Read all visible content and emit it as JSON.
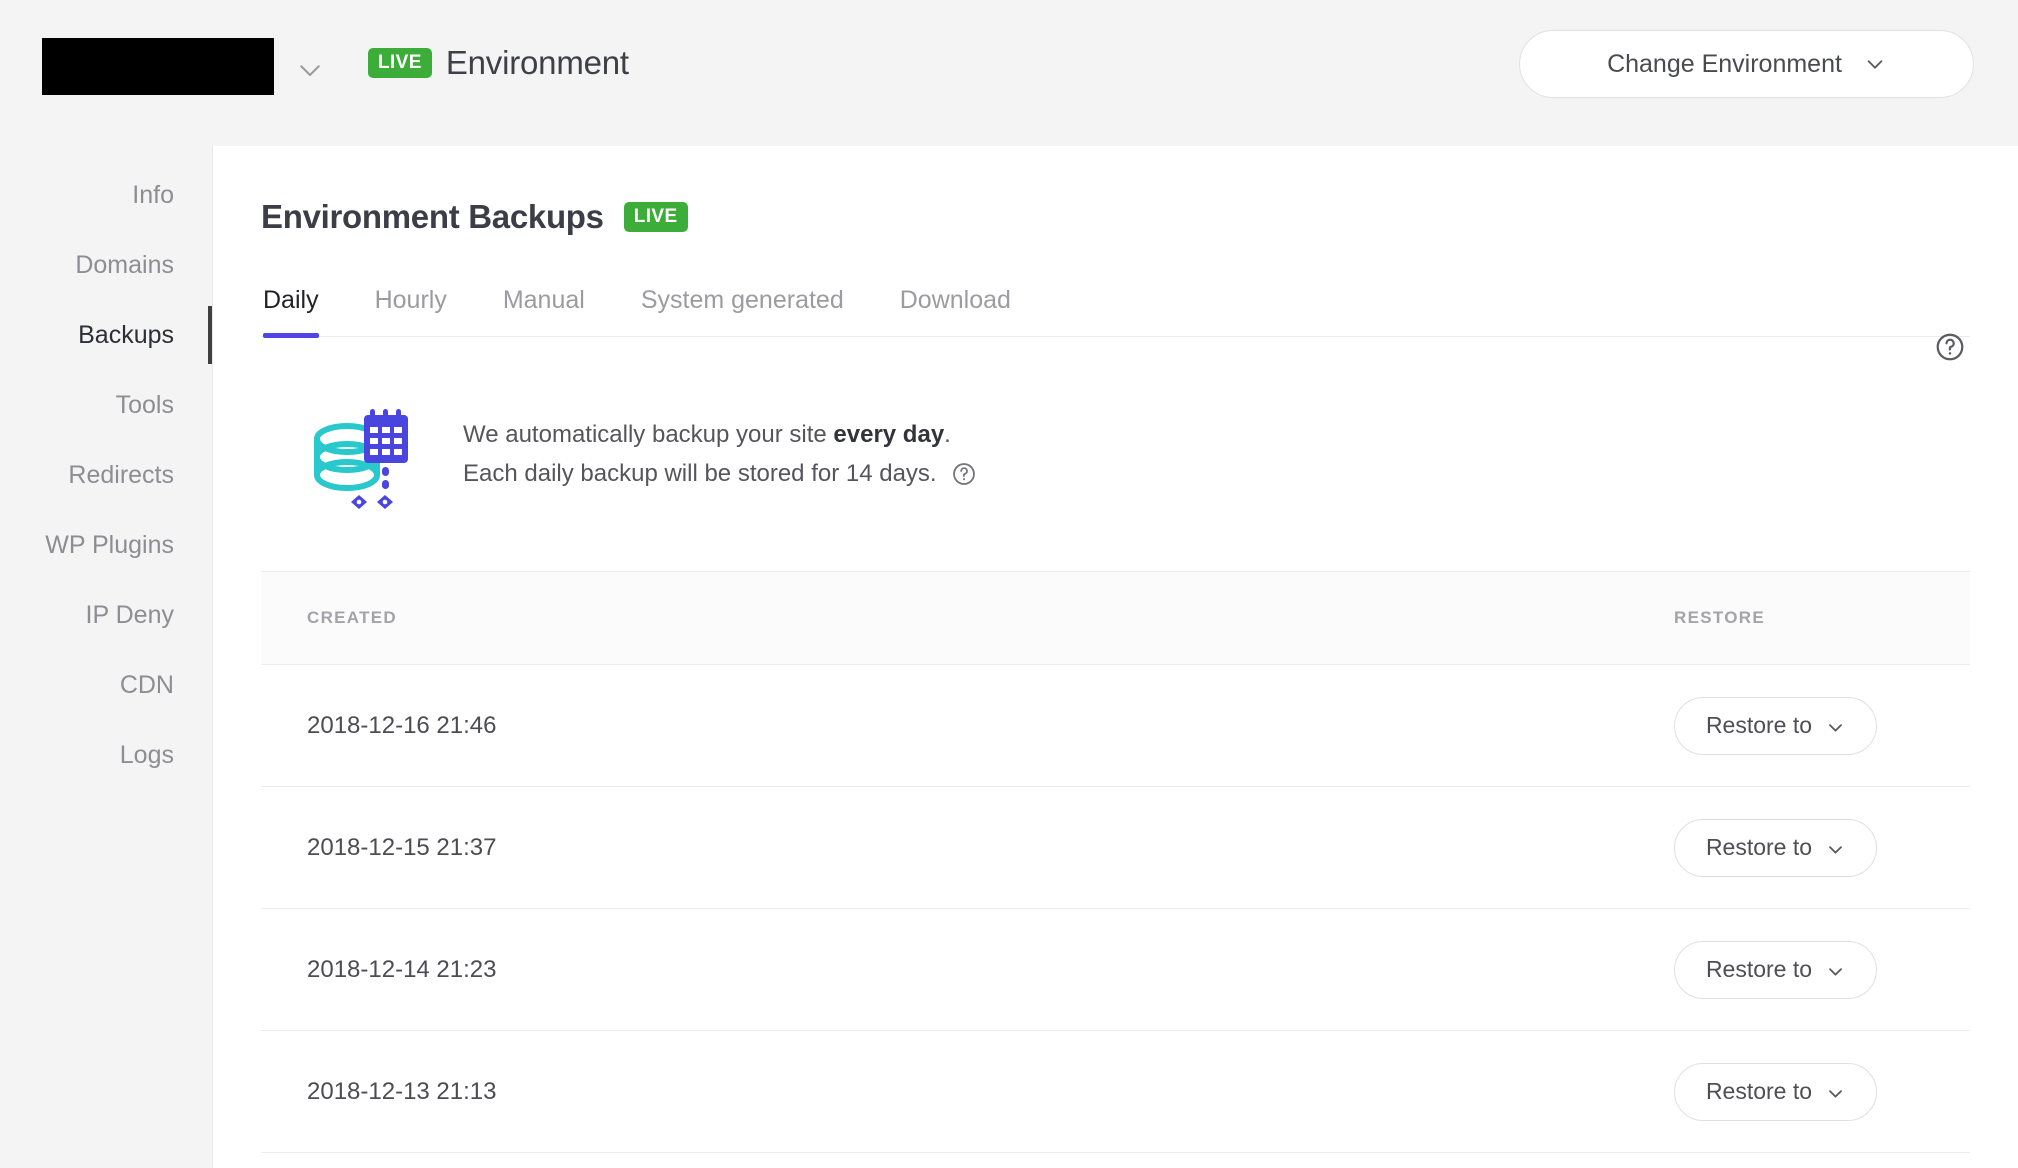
{
  "topbar": {
    "brand_redacted": true,
    "brand_dropdown_icon": "chevron-down-icon",
    "environment_badge": "LIVE",
    "environment_label": "Environment",
    "change_environment_label": "Change Environment",
    "change_environment_icon": "chevron-down-icon"
  },
  "sidebar": {
    "items": [
      {
        "label": "Info",
        "active": false
      },
      {
        "label": "Domains",
        "active": false
      },
      {
        "label": "Backups",
        "active": true
      },
      {
        "label": "Tools",
        "active": false
      },
      {
        "label": "Redirects",
        "active": false
      },
      {
        "label": "WP Plugins",
        "active": false
      },
      {
        "label": "IP Deny",
        "active": false
      },
      {
        "label": "CDN",
        "active": false
      },
      {
        "label": "Logs",
        "active": false
      }
    ]
  },
  "card": {
    "title": "Environment Backups",
    "badge": "LIVE",
    "help_icon": "question-circle-icon",
    "tabs": [
      {
        "label": "Daily",
        "active": true
      },
      {
        "label": "Hourly",
        "active": false
      },
      {
        "label": "Manual",
        "active": false
      },
      {
        "label": "System generated",
        "active": false
      },
      {
        "label": "Download",
        "active": false
      }
    ],
    "info": {
      "illustration": "database-calendar-backup-icon",
      "line1_prefix": "We automatically backup your site ",
      "line1_strong": "every day",
      "line1_suffix": ".",
      "line2": "Each daily backup will be stored for 14 days.",
      "line2_help_icon": "question-circle-icon"
    },
    "table": {
      "columns": [
        "CREATED",
        "RESTORE"
      ],
      "restore_button_label": "Restore to",
      "restore_button_icon": "chevron-down-icon",
      "rows": [
        {
          "created": "2018-12-16 21:46"
        },
        {
          "created": "2018-12-15 21:37"
        },
        {
          "created": "2018-12-14 21:23"
        },
        {
          "created": "2018-12-13 21:13"
        }
      ]
    }
  },
  "colors": {
    "live_green": "#3cad38",
    "tab_active_underline": "#4f46e5",
    "page_background": "#f4f4f4",
    "card_background": "#ffffff",
    "illustration_teal": "#28c8cd",
    "illustration_indigo": "#4b45e0"
  }
}
